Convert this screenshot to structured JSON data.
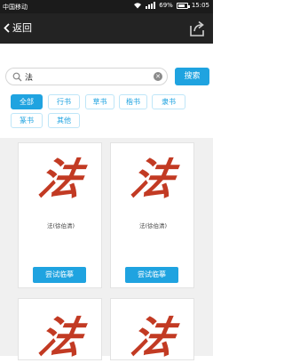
{
  "status_bar": {
    "carrier": "中国移动",
    "battery_percent": "69%",
    "battery_level": 0.69,
    "time": "15:05"
  },
  "header": {
    "back_label": "返回",
    "back_icon": "chevron-left-icon",
    "share_icon": "share-icon"
  },
  "search": {
    "value": "法",
    "placeholder": "",
    "button_label": "搜索"
  },
  "styles": {
    "chips": [
      "全部",
      "行书",
      "草书",
      "楷书",
      "隶书",
      "篆书",
      "其他"
    ],
    "selected": "全部"
  },
  "results": [
    {
      "glyph": "法",
      "caption": "法(徐伯清)",
      "button": "尝试临摹"
    },
    {
      "glyph": "法",
      "caption": "法(徐伯清)",
      "button": "尝试临摹"
    },
    {
      "glyph": "法",
      "caption": "",
      "button": ""
    },
    {
      "glyph": "法",
      "caption": "",
      "button": ""
    }
  ],
  "colors": {
    "accent": "#1fa3e0",
    "ink": "#c23a23",
    "titlebar": "#232323"
  }
}
